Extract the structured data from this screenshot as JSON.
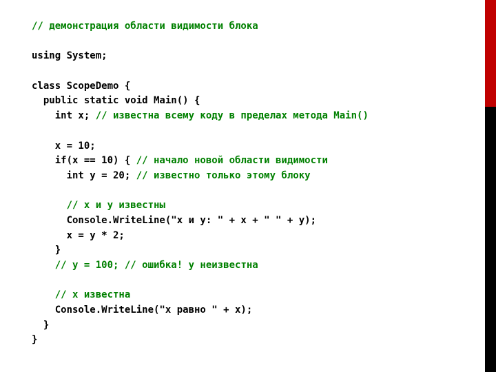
{
  "accent": {
    "red": "#c00000",
    "black": "#000000",
    "comment": "#008000"
  },
  "lines": [
    {
      "parts": [
        {
          "t": "// демонстрация области видимости блока",
          "c": true
        }
      ]
    },
    {
      "parts": [
        {
          "t": "",
          "c": false
        }
      ]
    },
    {
      "parts": [
        {
          "t": "using System;",
          "c": false
        }
      ]
    },
    {
      "parts": [
        {
          "t": "",
          "c": false
        }
      ]
    },
    {
      "parts": [
        {
          "t": "class ScopeDemo {",
          "c": false
        }
      ]
    },
    {
      "parts": [
        {
          "t": "  public static void Main() {",
          "c": false
        }
      ]
    },
    {
      "parts": [
        {
          "t": "    int x; ",
          "c": false
        },
        {
          "t": "// известна всему коду в пределах метода Main()",
          "c": true
        }
      ]
    },
    {
      "parts": [
        {
          "t": "",
          "c": false
        }
      ]
    },
    {
      "parts": [
        {
          "t": "    x = 10;",
          "c": false
        }
      ]
    },
    {
      "parts": [
        {
          "t": "    if(x == 10) { ",
          "c": false
        },
        {
          "t": "// начало новой области видимости",
          "c": true
        }
      ]
    },
    {
      "parts": [
        {
          "t": "      int y = 20; ",
          "c": false
        },
        {
          "t": "// известно только этому блоку",
          "c": true
        }
      ]
    },
    {
      "parts": [
        {
          "t": "",
          "c": false
        }
      ]
    },
    {
      "parts": [
        {
          "t": "      ",
          "c": false
        },
        {
          "t": "// x и y известны",
          "c": true
        }
      ]
    },
    {
      "parts": [
        {
          "t": "      Console.WriteLine(\"x и y: \" + x + \" \" + y);",
          "c": false
        }
      ]
    },
    {
      "parts": [
        {
          "t": "      x = y * 2;",
          "c": false
        }
      ]
    },
    {
      "parts": [
        {
          "t": "    }",
          "c": false
        }
      ]
    },
    {
      "parts": [
        {
          "t": "    ",
          "c": false
        },
        {
          "t": "// y = 100; // ошибка! y неизвестна",
          "c": true
        }
      ]
    },
    {
      "parts": [
        {
          "t": "",
          "c": false
        }
      ]
    },
    {
      "parts": [
        {
          "t": "    ",
          "c": false
        },
        {
          "t": "// x известна",
          "c": true
        }
      ]
    },
    {
      "parts": [
        {
          "t": "    Console.WriteLine(\"x равно \" + x);",
          "c": false
        }
      ]
    },
    {
      "parts": [
        {
          "t": "  }",
          "c": false
        }
      ]
    },
    {
      "parts": [
        {
          "t": "}",
          "c": false
        }
      ]
    }
  ]
}
